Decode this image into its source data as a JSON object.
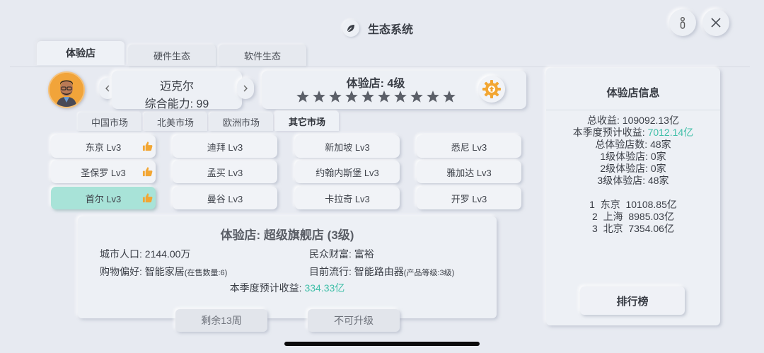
{
  "header": {
    "title": "生态系统"
  },
  "tabs": [
    {
      "label": "体验店",
      "active": true
    },
    {
      "label": "硬件生态",
      "active": false
    },
    {
      "label": "软件生态",
      "active": false
    }
  ],
  "manager": {
    "name": "迈克尔",
    "ability": "综合能力: 99"
  },
  "store_level": {
    "title": "体验店: 4级",
    "stars_total": 10,
    "stars_filled": 10
  },
  "markets": [
    {
      "label": "中国市场",
      "active": false
    },
    {
      "label": "北美市场",
      "active": false
    },
    {
      "label": "欧洲市场",
      "active": false
    },
    {
      "label": "其它市场",
      "active": true
    }
  ],
  "cities": [
    {
      "label": "东京 Lv3",
      "thumb": true,
      "selected": false
    },
    {
      "label": "迪拜 Lv3",
      "thumb": false,
      "selected": false
    },
    {
      "label": "新加坡 Lv3",
      "thumb": false,
      "selected": false
    },
    {
      "label": "悉尼 Lv3",
      "thumb": false,
      "selected": false
    },
    {
      "label": "圣保罗 Lv3",
      "thumb": true,
      "selected": false
    },
    {
      "label": "孟买 Lv3",
      "thumb": false,
      "selected": false
    },
    {
      "label": "约翰内斯堡 Lv3",
      "thumb": false,
      "selected": false
    },
    {
      "label": "雅加达 Lv3",
      "thumb": false,
      "selected": false
    },
    {
      "label": "首尔 Lv3",
      "thumb": true,
      "selected": true
    },
    {
      "label": "曼谷 Lv3",
      "thumb": false,
      "selected": false
    },
    {
      "label": "卡拉奇 Lv3",
      "thumb": false,
      "selected": false
    },
    {
      "label": "开罗 Lv3",
      "thumb": false,
      "selected": false
    }
  ],
  "detail": {
    "title": "体验店: 超级旗舰店 (3级)",
    "population_label": "城市人口: ",
    "population_value": "2144.00万",
    "wealth_label": "民众财富: ",
    "wealth_value": "富裕",
    "preference_label": "购物偏好: ",
    "preference_value": "智能家居",
    "preference_note": "(在售数量:6)",
    "trend_label": "目前流行: ",
    "trend_value": "智能路由器",
    "trend_note": "(产品等级:3级)",
    "season_income_label": "本季度预计收益: ",
    "season_income_value": "334.33亿"
  },
  "buttons": {
    "weeks_left": "剩余13周",
    "upgrade": "不可升级",
    "ranking": "排行榜"
  },
  "info": {
    "title": "体验店信息",
    "total_income": "总收益: 109092.13亿",
    "season_income_label": "本季度预计收益: ",
    "season_income_value": "7012.14亿",
    "total_stores": "总体验店数: 48家",
    "level1": "1级体验店: 0家",
    "level2": "2级体验店: 0家",
    "level3": "3级体验店: 48家",
    "ranking": [
      "1  东京  10108.85亿",
      "2  上海  8985.03亿",
      "3  北京  7354.06亿"
    ]
  },
  "colors": {
    "accent_teal": "#3fbfa8",
    "selected_bg": "#a8e3d8",
    "avatar_bg": "#f1a43a",
    "gear": "#f2a633"
  }
}
